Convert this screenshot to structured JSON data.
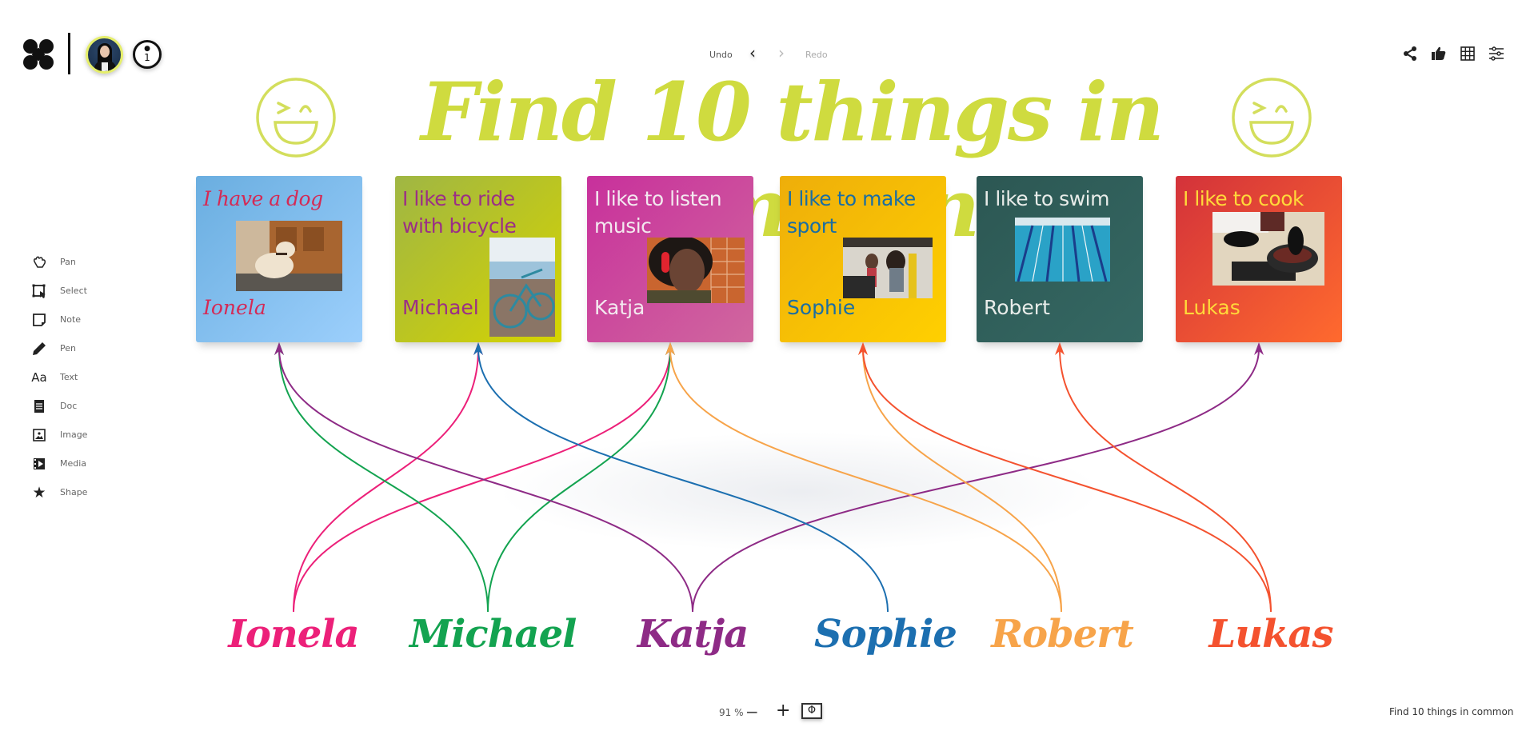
{
  "header": {
    "logo_icon": "clover-logo-icon",
    "user_avatar": "user-avatar",
    "users_online_count": "1",
    "undo_label": "Undo",
    "redo_label": "Redo",
    "undo_icon": "‹",
    "redo_icon": "›",
    "right_icons": [
      "share-icon",
      "thumbs-up-icon",
      "grid-icon",
      "settings-sliders-icon"
    ]
  },
  "toolbar": {
    "items": [
      {
        "label": "Pan",
        "icon": "hand-icon"
      },
      {
        "label": "Select",
        "icon": "select-icon"
      },
      {
        "label": "Note",
        "icon": "note-icon"
      },
      {
        "label": "Pen",
        "icon": "pen-icon"
      },
      {
        "label": "Text",
        "icon": "text-icon",
        "glyph": "Aa"
      },
      {
        "label": "Doc",
        "icon": "doc-icon"
      },
      {
        "label": "Image",
        "icon": "image-icon"
      },
      {
        "label": "Media",
        "icon": "media-icon"
      },
      {
        "label": "Shape",
        "icon": "star-icon",
        "glyph": "★"
      }
    ]
  },
  "board": {
    "title": "Find 10 things in common",
    "title_color": "#cfdb3f",
    "cards": [
      {
        "text": "I have a dog",
        "name": "Ionela",
        "photo": "dog",
        "text_color": "#d42a55",
        "bg": [
          "#6aaee0",
          "#9ccffc"
        ]
      },
      {
        "text": "I like to ride with bicycle",
        "name": "Michael",
        "photo": "bicycle",
        "text_color": "#9b2f86",
        "bg": [
          "#9fb644",
          "#d6d400"
        ]
      },
      {
        "text": "I like to listen music",
        "name": "Katja",
        "photo": "girl-with-headphones",
        "text_color": "#f3e9ef",
        "bg": [
          "#c8309c",
          "#d0679e"
        ]
      },
      {
        "text": "I like to make sport",
        "name": "Sophie",
        "photo": "gym",
        "text_color": "#1a6ea3",
        "bg": [
          "#eeae0a",
          "#ffd000"
        ]
      },
      {
        "text": "I like to swim",
        "name": "Robert",
        "photo": "swimming-pool",
        "text_color": "#e8ece9",
        "bg": [
          "#2c5753",
          "#356863"
        ]
      },
      {
        "text": "I like to cook",
        "name": "Lukas",
        "photo": "cooking",
        "text_color": "#ffd93a",
        "bg": [
          "#d3323a",
          "#ff6a2e"
        ]
      }
    ],
    "people": [
      {
        "name": "Ionela",
        "color": "#ec2079",
        "links_to": [
          "Michael",
          "Katja"
        ]
      },
      {
        "name": "Michael",
        "color": "#13a350",
        "links_to": [
          "Ionela",
          "Katja"
        ]
      },
      {
        "name": "Katja",
        "color": "#8e2b86",
        "links_to": [
          "Ionela",
          "Lukas"
        ]
      },
      {
        "name": "Sophie",
        "color": "#1c6fb0",
        "links_to": [
          "Michael"
        ]
      },
      {
        "name": "Robert",
        "color": "#f7a44a",
        "links_to": [
          "Katja",
          "Sophie"
        ]
      },
      {
        "name": "Lukas",
        "color": "#f4522f",
        "links_to": [
          "Sophie",
          "Robert"
        ]
      }
    ]
  },
  "footer": {
    "zoom_level": "91 %",
    "zoom_out": "−",
    "zoom_in": "+",
    "fit_icon": "Φ",
    "board_name": "Find 10 things in common"
  }
}
